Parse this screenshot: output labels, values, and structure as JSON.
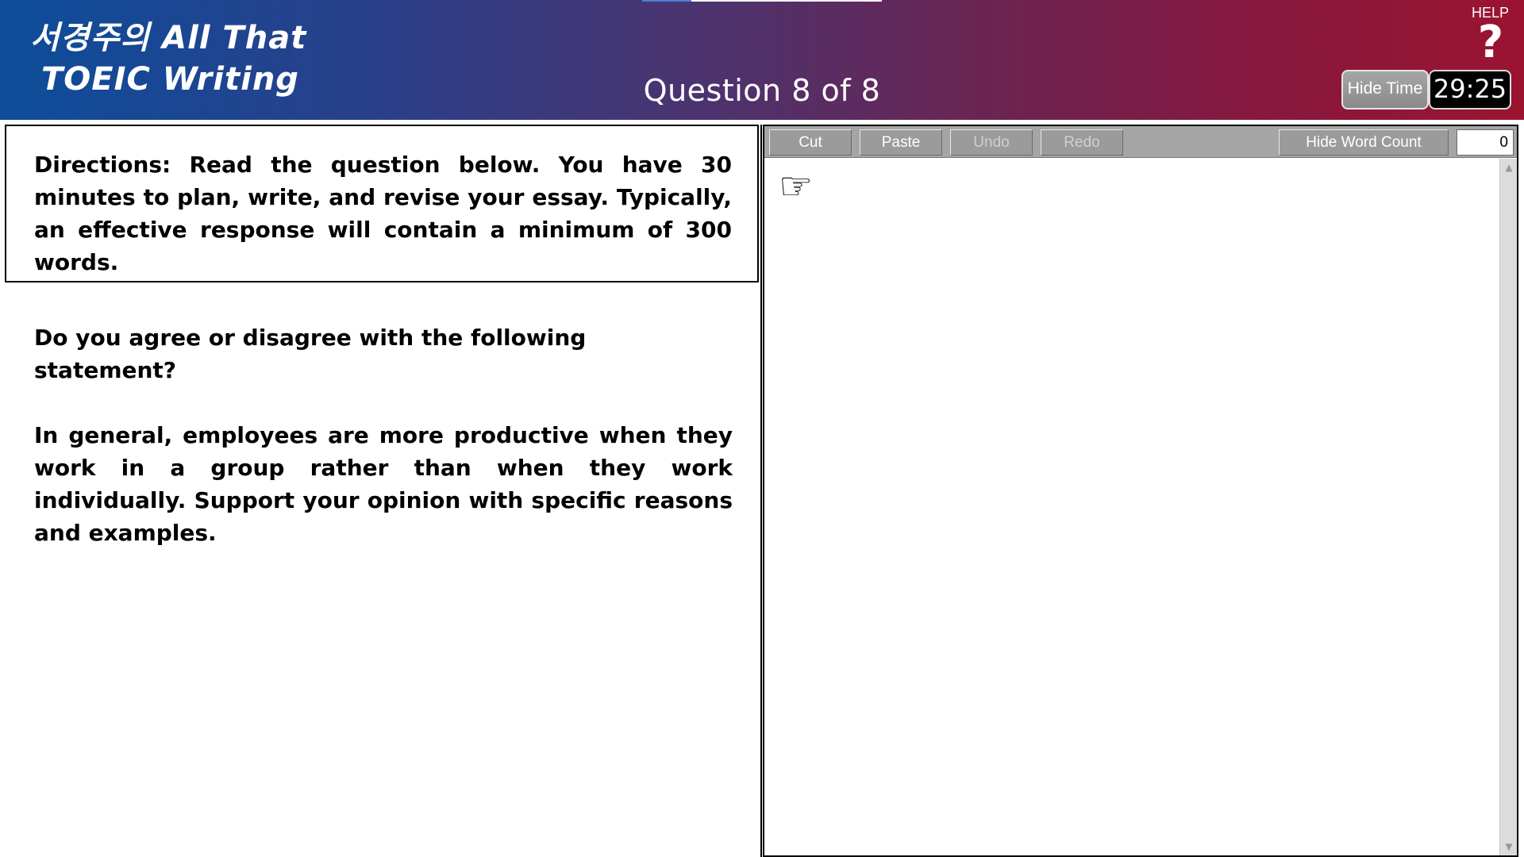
{
  "header": {
    "logo_line1": "서경주의 All That",
    "logo_line2": "TOEIC  Writing",
    "question_counter": "Question 8 of 8",
    "help_label": "HELP",
    "help_icon_glyph": "?",
    "hide_time_label": "Hide Time",
    "timer": "29:25"
  },
  "directions": {
    "text": "Directions: Read the question below. You have 30 minutes to plan, write, and revise your essay. Typically, an effective response will contain a minimum of 300 words."
  },
  "question": {
    "prompt": "Do you agree or disagree with the following statement?",
    "statement": "In general, employees are more productive when they work in a group rather than when they work individually. Support your opinion with specific reasons and examples."
  },
  "toolbar": {
    "cut_label": "Cut",
    "paste_label": "Paste",
    "undo_label": "Undo",
    "redo_label": "Redo",
    "hide_word_count_label": "Hide Word Count",
    "word_count": "0"
  },
  "editor": {
    "value": "",
    "pointer_icon_glyph": "☞"
  },
  "scrollbar": {
    "up_glyph": "▲",
    "down_glyph": "▼"
  },
  "colors": {
    "header_gradient_start": "#0d4d9a",
    "header_gradient_end": "#9a1430",
    "toolbar_bg": "#a5a5a5",
    "timer_bg": "#000000"
  }
}
